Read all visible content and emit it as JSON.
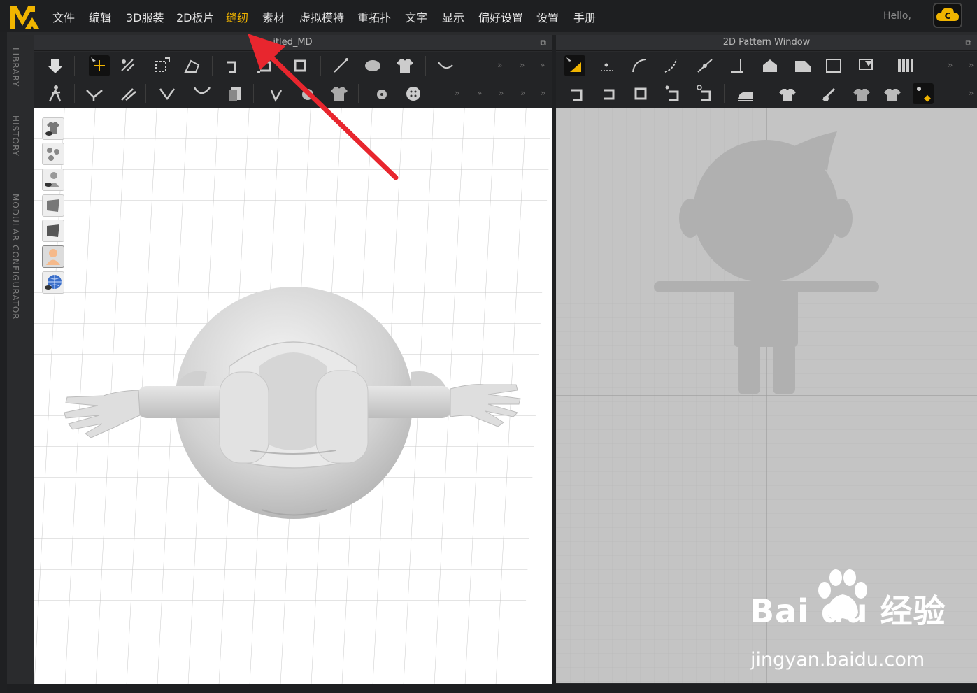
{
  "menu": {
    "items": [
      {
        "label": "文件"
      },
      {
        "label": "编辑"
      },
      {
        "label": "3D服装"
      },
      {
        "label": "2D板片"
      },
      {
        "label": "缝纫",
        "active": true
      },
      {
        "label": "素材"
      },
      {
        "label": "虚拟模特"
      },
      {
        "label": "重拓扑"
      },
      {
        "label": "文字"
      },
      {
        "label": "显示"
      },
      {
        "label": "偏好设置"
      },
      {
        "label": "设置"
      },
      {
        "label": "手册"
      }
    ],
    "greeting": "Hello,",
    "active_color": "#f0b400"
  },
  "side_tabs": [
    "LIBRARY",
    "HISTORY",
    "MODULAR CONFIGURATOR"
  ],
  "window_3d": {
    "title": "itled_MD"
  },
  "window_2d": {
    "title": "2D Pattern Window"
  },
  "overflow_glyph": "»",
  "watermark": {
    "logo": "Bai du 经验",
    "url": "jingyan.baidu.com"
  },
  "colors": {
    "accent": "#f0b400",
    "annotation_arrow": "#e8262e"
  }
}
